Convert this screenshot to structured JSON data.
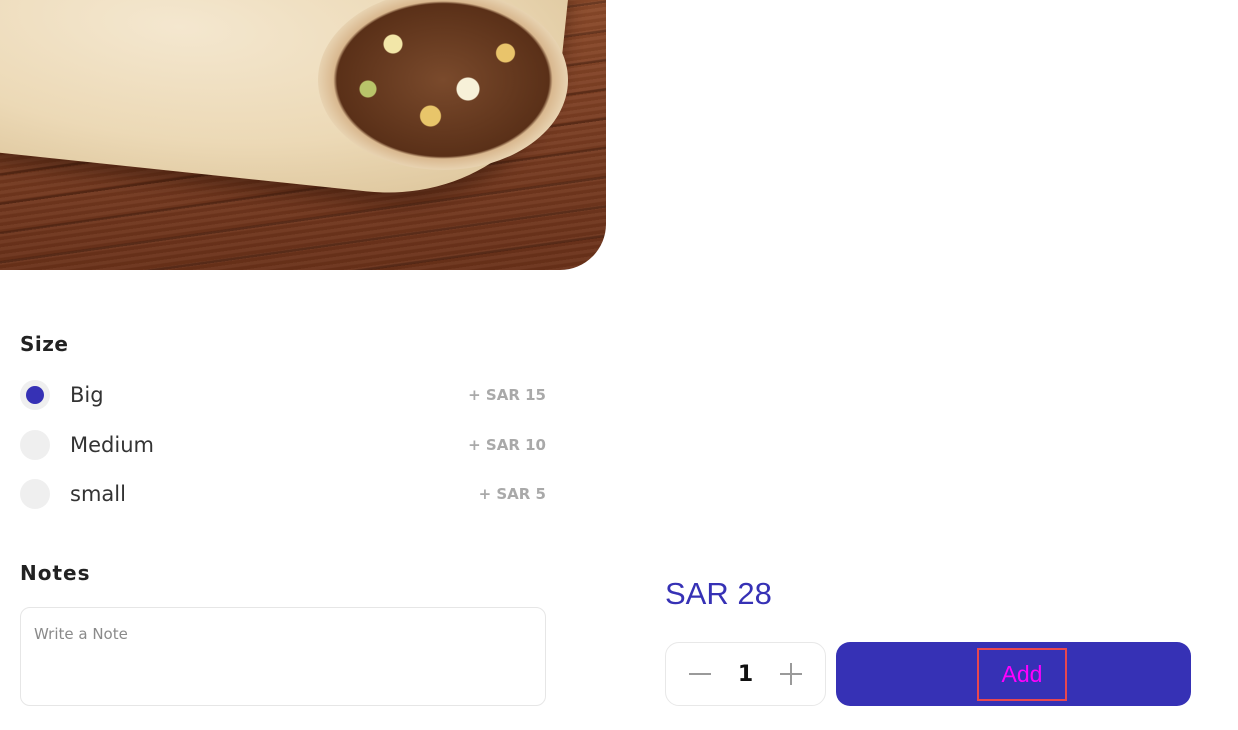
{
  "size_section": {
    "title": "Size",
    "options": [
      {
        "label": "Big",
        "price": "+ SAR 15",
        "selected": true
      },
      {
        "label": "Medium",
        "price": "+ SAR 10",
        "selected": false
      },
      {
        "label": "small",
        "price": "+ SAR 5",
        "selected": false
      }
    ]
  },
  "notes_section": {
    "title": "Notes",
    "placeholder": "Write a Note",
    "value": ""
  },
  "order": {
    "total": "SAR 28",
    "quantity": "1",
    "add_label": "Add"
  },
  "colors": {
    "accent": "#3631b5",
    "price_muted": "#a9a9a9",
    "highlight_border": "#e8474f",
    "add_text": "#ff00ff"
  },
  "icons": {
    "decrement": "minus-icon",
    "increment": "plus-icon"
  }
}
